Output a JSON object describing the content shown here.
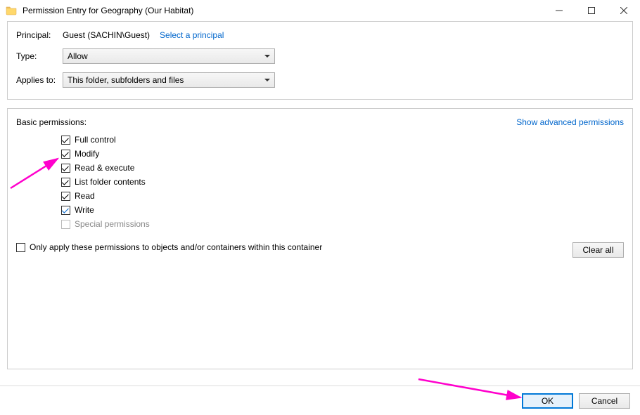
{
  "window": {
    "title": "Permission Entry for Geography (Our Habitat)"
  },
  "header": {
    "principal_label": "Principal:",
    "principal_value": "Guest (SACHIN\\Guest)",
    "select_principal": "Select a principal",
    "type_label": "Type:",
    "type_value": "Allow",
    "applies_label": "Applies to:",
    "applies_value": "This folder, subfolders and files"
  },
  "permissions": {
    "title": "Basic permissions:",
    "show_advanced": "Show advanced permissions",
    "items": [
      {
        "label": "Full control",
        "checked": true,
        "blue": false,
        "disabled": false
      },
      {
        "label": "Modify",
        "checked": true,
        "blue": false,
        "disabled": false
      },
      {
        "label": "Read & execute",
        "checked": true,
        "blue": false,
        "disabled": false
      },
      {
        "label": "List folder contents",
        "checked": true,
        "blue": false,
        "disabled": false
      },
      {
        "label": "Read",
        "checked": true,
        "blue": false,
        "disabled": false
      },
      {
        "label": "Write",
        "checked": true,
        "blue": true,
        "disabled": false
      },
      {
        "label": "Special permissions",
        "checked": false,
        "blue": false,
        "disabled": true
      }
    ],
    "only_apply": "Only apply these permissions to objects and/or containers within this container",
    "clear_all": "Clear all"
  },
  "footer": {
    "ok": "OK",
    "cancel": "Cancel"
  }
}
